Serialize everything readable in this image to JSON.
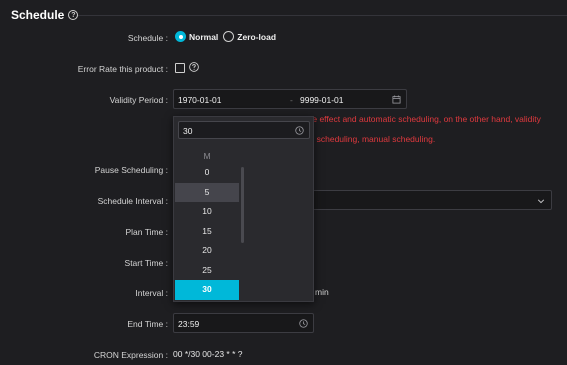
{
  "section": {
    "title": "Schedule"
  },
  "labels": {
    "schedule": "Schedule :",
    "error_rate": "Error Rate this product :",
    "validity_period": "Validity Period :",
    "pause_scheduling": "Pause Scheduling :",
    "schedule_interval": "Schedule Interval :",
    "plan_time": "Plan Time :",
    "start_time": "Start Time :",
    "interval": "Interval :",
    "end_time": "End Time :",
    "cron_expression": "CRON Expression :"
  },
  "schedule_options": {
    "normal": "Normal",
    "zero_load": "Zero-load",
    "selected": "normal"
  },
  "validity": {
    "start": "1970-01-01",
    "separator": "-",
    "end": "9999-01-01"
  },
  "errors": {
    "line1": "te effect and automatic scheduling, on the other hand, validity",
    "line2": "c scheduling, manual scheduling."
  },
  "interval_suffix": "min",
  "end_time": {
    "value": "23:59"
  },
  "cron": {
    "value": "00 */30 00-23 * * ?"
  },
  "dropdown": {
    "input_value": "30",
    "header": "M",
    "items": [
      "0",
      "5",
      "10",
      "15",
      "20",
      "25",
      "30"
    ],
    "hovered": "5",
    "selected": "30"
  },
  "icons": {
    "help": "help-icon",
    "calendar": "calendar-icon",
    "clock": "clock-icon",
    "chevron": "chevron-down-icon"
  },
  "colors": {
    "accent": "#00b8d9",
    "error": "#e0393e",
    "background": "#1e1e21"
  }
}
